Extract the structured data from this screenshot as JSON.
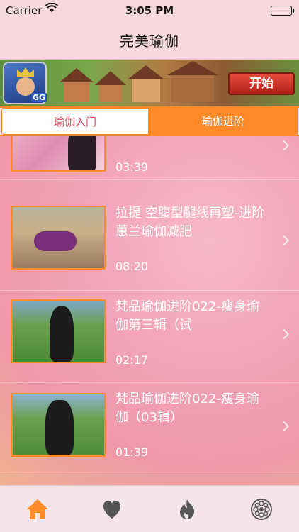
{
  "status_bar": {
    "carrier": "Carrier",
    "time": "3:05 PM"
  },
  "nav": {
    "title": "完美瑜伽"
  },
  "ad": {
    "icon_badge": "GG",
    "start_label": "开始"
  },
  "tabs": [
    {
      "label": "瑜伽入门",
      "selected": false
    },
    {
      "label": "瑜伽进阶",
      "selected": true
    }
  ],
  "videos": [
    {
      "title": "",
      "duration": "03:39"
    },
    {
      "title": "拉提 空腹型腿线再塑-进阶 蕙兰瑜伽减肥",
      "duration": "08:20"
    },
    {
      "title": "梵品瑜伽进阶022-瘦身瑜伽第三辑（试",
      "duration": "02:17"
    },
    {
      "title": "梵品瑜伽进阶022-瘦身瑜伽（03辑）",
      "duration": "01:39"
    }
  ],
  "tab_bar": {
    "items": [
      "home-icon",
      "heart-icon",
      "flame-icon",
      "flower-icon"
    ],
    "active": "home-icon"
  },
  "colors": {
    "accent": "#ff8a2a",
    "tab_selected_text": "#ffffff",
    "tab_unselected_text": "#e2435d"
  }
}
